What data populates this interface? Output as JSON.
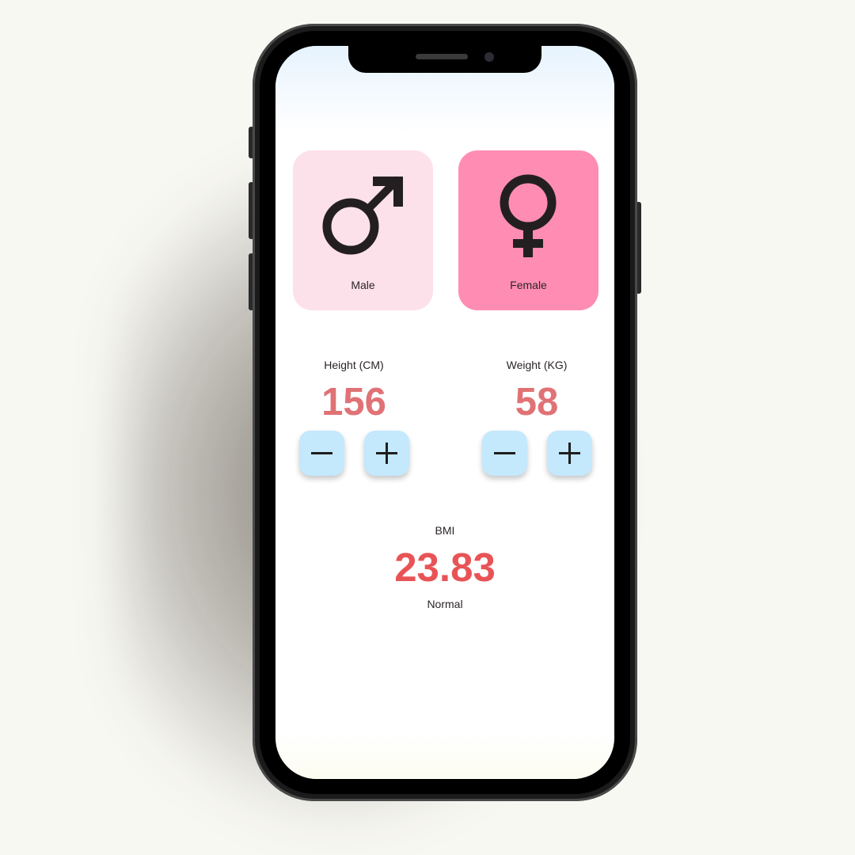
{
  "gender": {
    "male": {
      "label": "Male",
      "icon": "male-symbol-icon",
      "bg": "#fde1ea"
    },
    "female": {
      "label": "Female",
      "icon": "female-symbol-icon",
      "bg": "#ff8db3",
      "selected": true
    }
  },
  "height": {
    "label": "Height (CM)",
    "value": "156"
  },
  "weight": {
    "label": "Weight (KG)",
    "value": "58"
  },
  "controls": {
    "decrement_icon": "minus-icon",
    "increment_icon": "plus-icon",
    "button_bg": "#c4e8fc"
  },
  "bmi": {
    "label": "BMI",
    "value": "23.83",
    "category": "Normal"
  },
  "colors": {
    "value_accent": "#e07276",
    "bmi_accent": "#e85456"
  }
}
